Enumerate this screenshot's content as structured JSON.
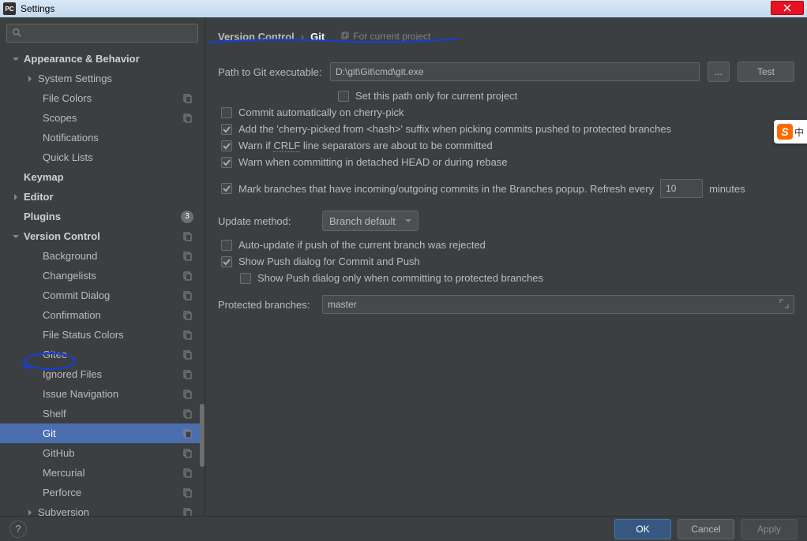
{
  "window": {
    "title": "Settings"
  },
  "breadcrumb": {
    "section": "Version Control",
    "page": "Git",
    "hint": "For current project"
  },
  "sidebar": {
    "plugins_count": "3",
    "items": [
      {
        "label": "Appearance & Behavior",
        "bold": true,
        "arrow": "down",
        "indent": 0
      },
      {
        "label": "System Settings",
        "arrow": "right",
        "indent": 1
      },
      {
        "label": "File Colors",
        "indent": 2,
        "badge": true
      },
      {
        "label": "Scopes",
        "indent": 2,
        "badge": true
      },
      {
        "label": "Notifications",
        "indent": 2
      },
      {
        "label": "Quick Lists",
        "indent": 2
      },
      {
        "label": "Keymap",
        "bold": true,
        "indent": 0
      },
      {
        "label": "Editor",
        "bold": true,
        "arrow": "right",
        "indent": 0
      },
      {
        "label": "Plugins",
        "bold": true,
        "indent": 0,
        "count": true
      },
      {
        "label": "Version Control",
        "bold": true,
        "arrow": "down",
        "indent": 0,
        "badge": true
      },
      {
        "label": "Background",
        "indent": 2,
        "badge": true
      },
      {
        "label": "Changelists",
        "indent": 2,
        "badge": true
      },
      {
        "label": "Commit Dialog",
        "indent": 2,
        "badge": true
      },
      {
        "label": "Confirmation",
        "indent": 2,
        "badge": true
      },
      {
        "label": "File Status Colors",
        "indent": 2,
        "badge": true
      },
      {
        "label": "Gitee",
        "indent": 2,
        "badge": true
      },
      {
        "label": "Ignored Files",
        "indent": 2,
        "badge": true
      },
      {
        "label": "Issue Navigation",
        "indent": 2,
        "badge": true
      },
      {
        "label": "Shelf",
        "indent": 2,
        "badge": true
      },
      {
        "label": "Git",
        "indent": 2,
        "badge": true,
        "selected": true
      },
      {
        "label": "GitHub",
        "indent": 2,
        "badge": true
      },
      {
        "label": "Mercurial",
        "indent": 2,
        "badge": true
      },
      {
        "label": "Perforce",
        "indent": 2,
        "badge": true
      },
      {
        "label": "Subversion",
        "arrow": "right",
        "indent": 1,
        "badge": true
      }
    ]
  },
  "form": {
    "path_label": "Path to Git executable:",
    "path_value": "D:\\git\\Git\\cmd\\git.exe",
    "browse": "...",
    "test": "Test",
    "set_path_project": "Set this path only for current project",
    "commit_auto_cherry": "Commit automatically on cherry-pick",
    "add_cherry_suffix": "Add the 'cherry-picked from <hash>' suffix when picking commits pushed to protected branches",
    "warn_crlf_pre": "Warn if ",
    "warn_crlf_u": "CRLF",
    "warn_crlf_post": " line separators are about to be committed",
    "warn_detached": "Warn when committing in detached HEAD or during rebase",
    "mark_branches": "Mark branches that have incoming/outgoing commits in the Branches popup.  Refresh every",
    "refresh_value": "10",
    "minutes": "minutes",
    "update_method_label": "Update method:",
    "update_method_value": "Branch default",
    "auto_update_push": "Auto-update if push of the current branch was rejected",
    "show_push_dialog": "Show Push dialog for Commit and Push",
    "show_push_protected": "Show Push dialog only when committing to protected branches",
    "protected_label": "Protected branches:",
    "protected_value": "master"
  },
  "buttons": {
    "ok": "OK",
    "cancel": "Cancel",
    "apply": "Apply",
    "help": "?"
  }
}
